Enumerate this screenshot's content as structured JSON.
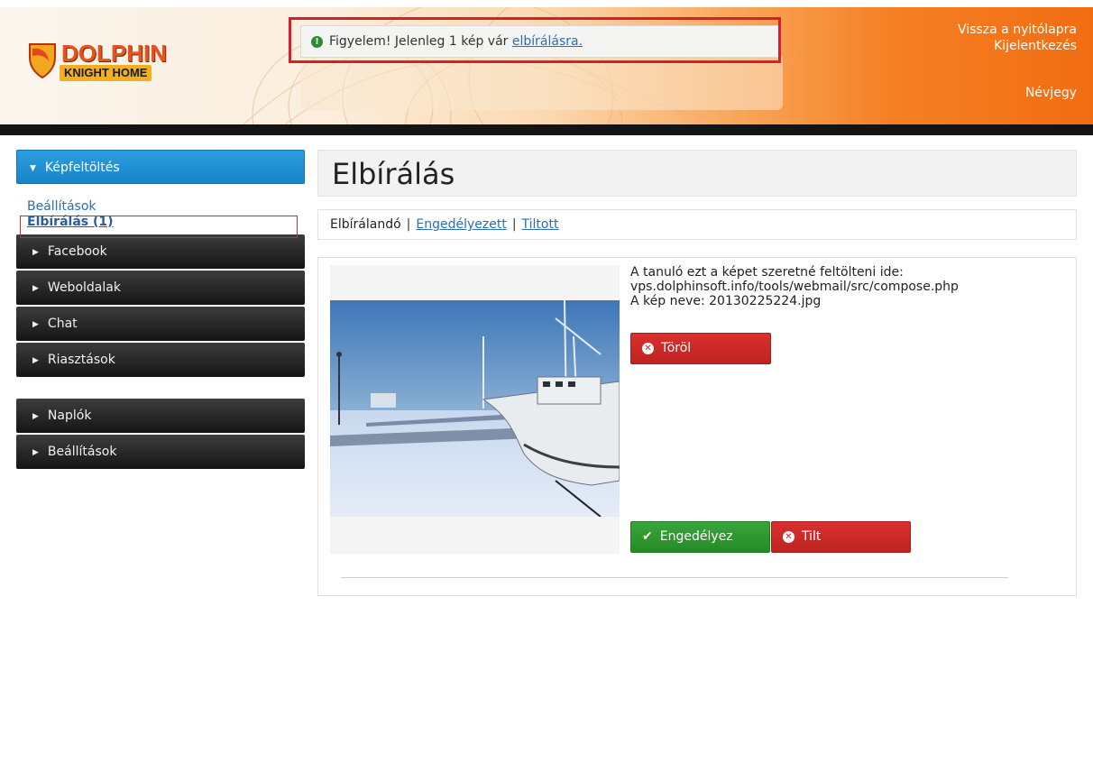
{
  "header": {
    "logo_brand": "DOLPHIN",
    "logo_sub": "KNIGHT HOME",
    "alert_text": "Figyelem! Jelenleg 1 kép vár",
    "alert_link": "elbírálásra.",
    "links": {
      "home": "Vissza a nyitólapra",
      "logout": "Kijelentkezés",
      "about": "Névjegy"
    }
  },
  "sidebar": {
    "active_label": "Képfeltöltés",
    "sub_items": [
      "Beállítások",
      "Elbírálás (1)"
    ],
    "group1": [
      "Facebook",
      "Weboldalak",
      "Chat",
      "Riasztások"
    ],
    "group2": [
      "Naplók",
      "Beállítások"
    ]
  },
  "main": {
    "title": "Elbírálás",
    "tabs": {
      "current": "Elbírálandó",
      "approved": "Engedélyezett",
      "denied": "Tiltott",
      "separator": "|"
    },
    "item": {
      "line1": "A tanuló ezt a képet szeretné feltölteni ide:",
      "line2": "vps.dolphinsoft.info/tools/webmail/src/compose.php",
      "line3": "A kép neve: 20130225224.jpg",
      "delete_label": "Töröl",
      "approve_label": "Engedélyez",
      "deny_label": "Tilt"
    }
  },
  "colors": {
    "alert_frame": "#d81e2a",
    "active_nav": "#1b8ad0",
    "dark_nav": "#222222",
    "btn_red": "#c8272b",
    "btn_green": "#2e962f"
  }
}
